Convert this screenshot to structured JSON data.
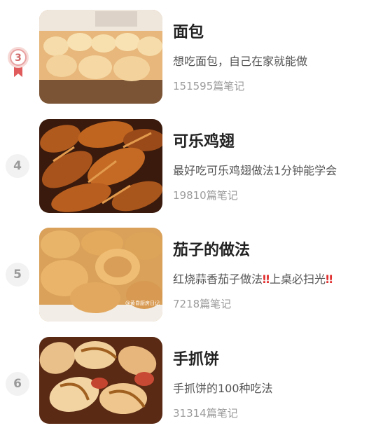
{
  "recipes": [
    {
      "rank": "3",
      "title": "面包",
      "desc": "想吃面包，自己在家就能做",
      "count": "151595篇笔记",
      "medal_color": "#e8a0a0"
    },
    {
      "rank": "4",
      "title": "可乐鸡翅",
      "desc": "最好吃可乐鸡翅做法1分钟能学会",
      "count": "19810篇笔记"
    },
    {
      "rank": "5",
      "title": "茄子的做法",
      "desc_part1": "红烧蒜香茄子做法",
      "desc_part2": "上桌必扫光",
      "bang": "‼",
      "watermark": "@黄昏厨房日记",
      "count": "7218篇笔记"
    },
    {
      "rank": "6",
      "title": "手抓饼",
      "desc": "手抓饼的100种吃法",
      "count": "31314篇笔记"
    }
  ]
}
